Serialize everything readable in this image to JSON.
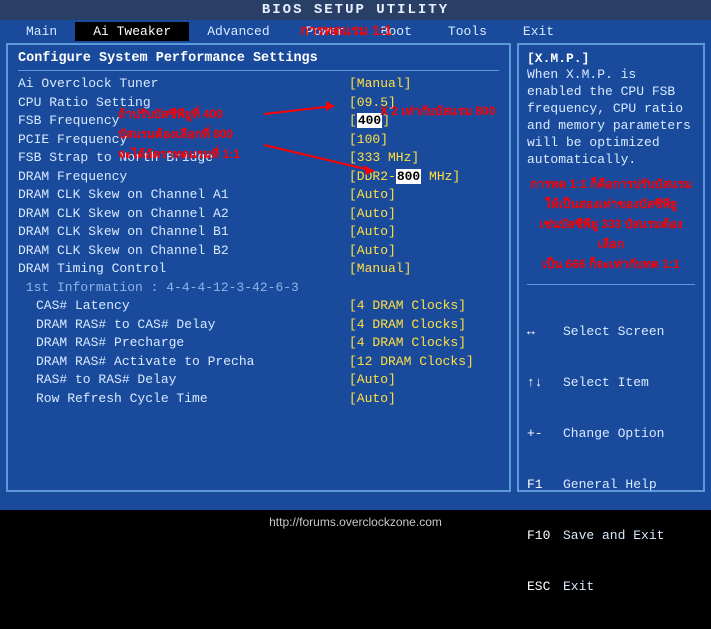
{
  "title": "BIOS SETUP UTILITY",
  "menu": [
    "Main",
    "Ai Tweaker",
    "Advanced",
    "Power",
    "Boot",
    "Tools",
    "Exit"
  ],
  "active_menu": "Ai Tweaker",
  "panel_header": "Configure System Performance Settings",
  "settings": [
    {
      "label": "Ai Overclock Tuner",
      "value": "[Manual]"
    },
    {
      "label": "CPU Ratio Setting",
      "value": "[09.5]"
    },
    {
      "label": "FSB Frequency",
      "value_pre": "[",
      "value_hl": "400",
      "value_post": "]"
    },
    {
      "label": "PCIE Frequency",
      "value": "[100]"
    },
    {
      "label": "FSB Strap to North Bridge",
      "value": "[333 MHz]"
    },
    {
      "label": "DRAM Frequency",
      "value_pre": "[DDR2-",
      "value_hl": "800",
      "value_post": " MHz]"
    },
    {
      "label": "DRAM CLK Skew on Channel A1",
      "value": "[Auto]"
    },
    {
      "label": "DRAM CLK Skew on Channel A2",
      "value": "[Auto]"
    },
    {
      "label": "DRAM CLK Skew on Channel B1",
      "value": "[Auto]"
    },
    {
      "label": "DRAM CLK Skew on Channel B2",
      "value": "[Auto]"
    },
    {
      "label": "DRAM Timing Control",
      "value": "[Manual]"
    }
  ],
  "info_line": " 1st Information : 4-4-4-12-3-42-6-3",
  "sub_settings": [
    {
      "label": "CAS# Latency",
      "value": "[4 DRAM Clocks]"
    },
    {
      "label": "DRAM RAS# to CAS# Delay",
      "value": "[4 DRAM Clocks]"
    },
    {
      "label": "DRAM RAS# Precharge",
      "value": "[4 DRAM Clocks]"
    },
    {
      "label": "DRAM RAS# Activate to Precha",
      "value": "[12 DRAM Clocks]"
    },
    {
      "label": "RAS# to RAS# Delay",
      "value": "[Auto]"
    },
    {
      "label": "Row Refresh Cycle Time",
      "value": "[Auto]"
    }
  ],
  "help": {
    "topic": "[X.M.P.]",
    "body": "When X.M.P. is enabled the CPU FSB frequency, CPU ratio and memory parameters will be optimized automatically."
  },
  "legend": [
    {
      "k": "↔",
      "v": "Select Screen"
    },
    {
      "k": "↑↓",
      "v": "Select Item"
    },
    {
      "k": "+-",
      "v": "Change Option"
    },
    {
      "k": "F1",
      "v": "General Help"
    },
    {
      "k": "F10",
      "v": "Save and Exit"
    },
    {
      "k": "ESC",
      "v": "Exit"
    }
  ],
  "annotations": {
    "title_anno": "การทดแรม 1:1",
    "a1": "ถ้าปรับบัสซีพียูที่ 400",
    "a2": "บัสแรมต้องเลือกที่ 800",
    "a3": "จะได้อัตราทดแรมที่ 1:1",
    "a4": "X 2 เท่ากับบัสแรม 800",
    "r1": "การทด 1:1 ก็คือการปรับบัสแรม",
    "r2": "ให้เป็นสองเท่าของบัสซีพียู",
    "r3": "เช่นบัสซีพียู 333 บัสแรมต้องเลือก",
    "r4": "เป็น 666 ก็จะเท่ากับทด 1:1"
  },
  "footer": "http://forums.overclockzone.com"
}
